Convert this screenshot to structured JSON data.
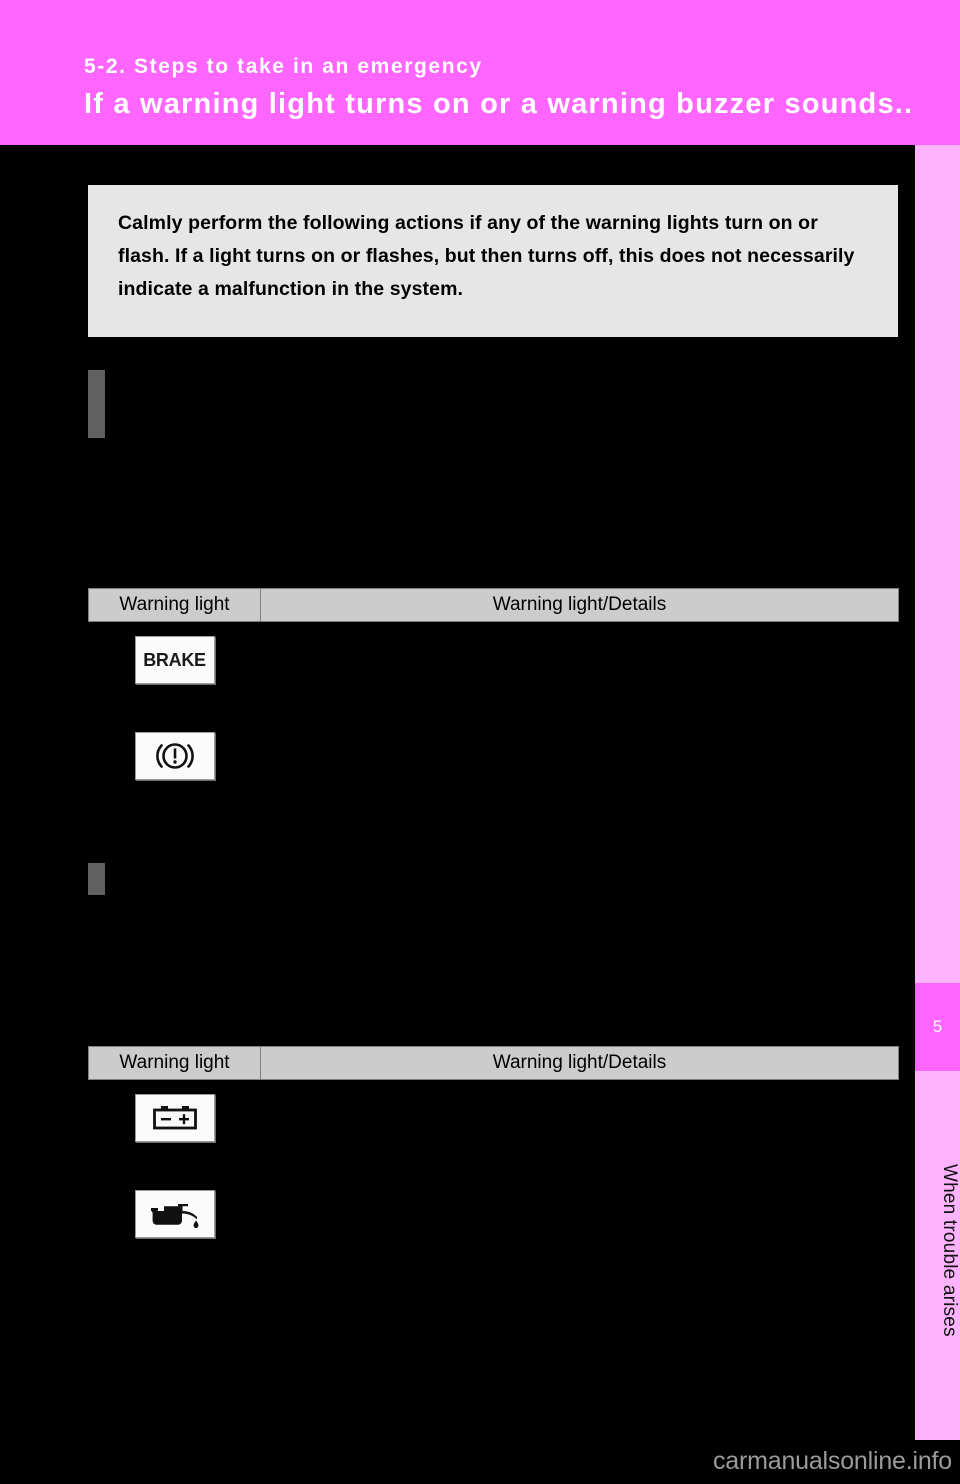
{
  "header": {
    "section_label": "5-2. Steps to take in an emergency",
    "page_title": "If a warning light turns on or a warning buzzer sounds...",
    "band_color": "#ff66ff",
    "text_color": "#ffffff"
  },
  "sidebar": {
    "chapter_number": "5",
    "chapter_title": "When trouble arises",
    "strip_color": "#ffb3ff",
    "tab_color": "#ff66ff"
  },
  "notice": {
    "text": "Calmly perform the following actions if any of the warning lights turn on or flash. If a light turns on or flashes, but then turns off, this does not necessarily indicate a malfunction in the system.",
    "background": "#e6e6e6",
    "text_color": "#000000"
  },
  "markers": [
    {
      "name": "section-marker-1",
      "color": "#606060"
    },
    {
      "name": "section-marker-2",
      "color": "#606060"
    }
  ],
  "tables": [
    {
      "name": "warning-light-table-1",
      "headers": {
        "light": "Warning light",
        "details": "Warning light/Details"
      },
      "header_background": "#cccccc",
      "rows": [
        {
          "icon": "brake-text-icon",
          "icon_label": "BRAKE",
          "details": ""
        },
        {
          "icon": "brake-system-warning-icon",
          "icon_label": "",
          "details": ""
        }
      ]
    },
    {
      "name": "warning-light-table-2",
      "headers": {
        "light": "Warning light",
        "details": "Warning light/Details"
      },
      "header_background": "#cccccc",
      "rows": [
        {
          "icon": "battery-charging-icon",
          "icon_label": "",
          "details": ""
        },
        {
          "icon": "oil-pressure-icon",
          "icon_label": "",
          "details": ""
        }
      ]
    }
  ],
  "watermark": {
    "text": "carmanualsonline.info",
    "color": "#9b9b9b"
  }
}
